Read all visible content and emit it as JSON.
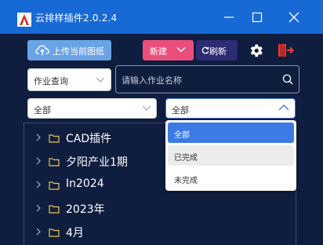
{
  "window": {
    "title": "云排样插件2.0.2.4",
    "controls": [
      "minimize-icon",
      "maximize-icon",
      "close-icon"
    ]
  },
  "toolbar": {
    "upload_label": "上传当前图纸",
    "new_label": "新建",
    "refresh_label": "刷新",
    "settings_icon": "gear-icon",
    "exit_icon": "exit-icon"
  },
  "filters": {
    "query_type": "作业查询",
    "search_placeholder": "请输入作业名称",
    "left_status": "全部",
    "right_status": "全部"
  },
  "dropdown": {
    "options": [
      "全部",
      "已完成",
      "未完成"
    ],
    "selected": "全部",
    "hovered": "已完成"
  },
  "tree": {
    "items": [
      "CAD插件",
      "夕阳产业1期",
      "In2024",
      "2023年",
      "4月"
    ]
  },
  "colors": {
    "titlebar": "#1769d6",
    "background": "#0f1d3f",
    "upload": "#6aa3e6",
    "new": "#ea4f7c",
    "refresh": "#2c2b73",
    "exit": "#e23c36",
    "folder": "#e8c84c",
    "selected_option": "#3c7be5"
  }
}
